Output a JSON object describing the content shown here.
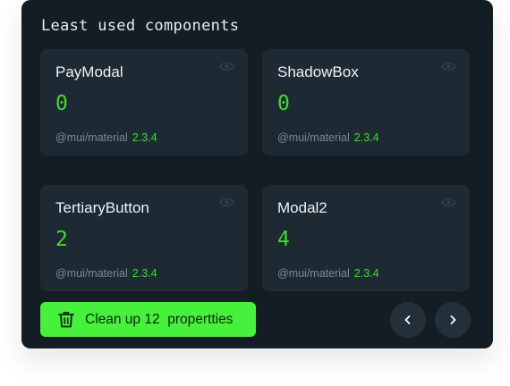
{
  "panel": {
    "title": "Least used components"
  },
  "cards": [
    {
      "name": "PayModal",
      "count": "0",
      "package": "@mui/material",
      "version": "2.3.4"
    },
    {
      "name": "ShadowBox",
      "count": "0",
      "package": "@mui/material",
      "version": "2.3.4"
    },
    {
      "name": "TertiaryButton",
      "count": "2",
      "package": "@mui/material",
      "version": "2.3.4"
    },
    {
      "name": "Modal2",
      "count": "4",
      "package": "@mui/material",
      "version": "2.3.4"
    }
  ],
  "actions": {
    "cleanup_label": "Clean up 12  propertties",
    "cleanup_icon": "trash-icon",
    "prev_icon": "chevron-left-icon",
    "next_icon": "chevron-right-icon"
  },
  "colors": {
    "panel_bg": "#141d24",
    "card_bg": "#1e2a33",
    "accent_green": "#47f03b",
    "value_green": "#3ddc2b"
  }
}
